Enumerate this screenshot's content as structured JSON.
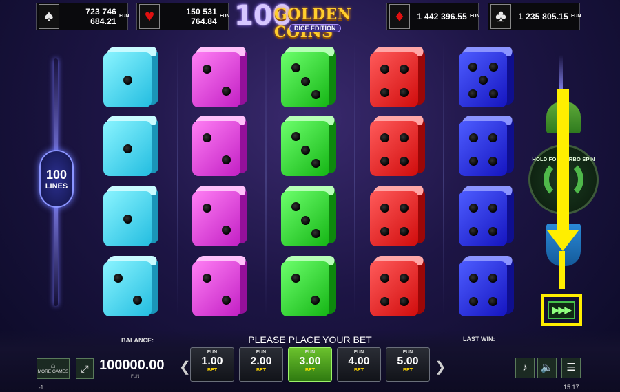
{
  "jackpots": [
    {
      "suit": "spade",
      "glyph": "♠",
      "amount": "723 746 684.21",
      "fun": "FUN"
    },
    {
      "suit": "heart",
      "glyph": "♥",
      "amount": "150 531 764.84",
      "fun": "FUN"
    },
    {
      "suit": "diamond",
      "glyph": "♦",
      "amount": "1 442 396.55",
      "fun": "FUN"
    },
    {
      "suit": "club",
      "glyph": "♣",
      "amount": "1 235 805.15",
      "fun": "FUN"
    }
  ],
  "logo": {
    "number": "100",
    "title": "GOLDEN COINS",
    "subtitle": "DICE EDITION"
  },
  "lines": {
    "number": "100",
    "label": "LINES"
  },
  "reels": [
    {
      "color": "cyan",
      "faces": [
        1,
        1,
        1,
        2
      ]
    },
    {
      "color": "magenta",
      "faces": [
        2,
        2,
        2,
        2
      ]
    },
    {
      "color": "green",
      "faces": [
        3,
        3,
        3,
        2
      ]
    },
    {
      "color": "red",
      "faces": [
        4,
        4,
        4,
        4
      ]
    },
    {
      "color": "blue",
      "faces": [
        5,
        4,
        4,
        4
      ]
    }
  ],
  "controls": {
    "turbo_hint": "HOLD FOR TURBO SPIN",
    "turbo_glyph": "▶▶▶",
    "autoplay_glyph": "↻"
  },
  "bottom": {
    "balance_label": "BALANCE:",
    "balance_value": "100000.00",
    "balance_currency": "FUN",
    "message": "PLEASE PLACE YOUR BET",
    "last_win_label": "LAST WIN:",
    "more_games": "MORE GAMES",
    "prev_glyph": "❮",
    "next_glyph": "❯",
    "bets": [
      {
        "fun": "FUN",
        "value": "1.00",
        "bet": "BET",
        "active": false
      },
      {
        "fun": "FUN",
        "value": "2.00",
        "bet": "BET",
        "active": false
      },
      {
        "fun": "FUN",
        "value": "3.00",
        "bet": "BET",
        "active": true
      },
      {
        "fun": "FUN",
        "value": "4.00",
        "bet": "BET",
        "active": false
      },
      {
        "fun": "FUN",
        "value": "5.00",
        "bet": "BET",
        "active": false
      }
    ],
    "music_glyph": "♪",
    "sound_glyph": "🔈",
    "menu_glyph": "☰",
    "expand_glyph": "⤢"
  },
  "status": {
    "left": "-1",
    "time": "15:17"
  },
  "highlight_color": "#ffee00"
}
